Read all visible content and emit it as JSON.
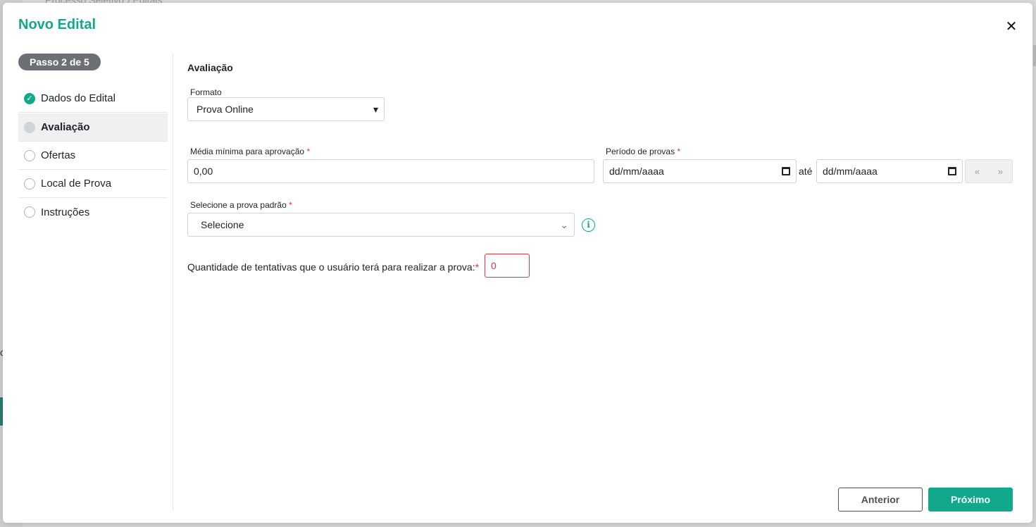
{
  "background": {
    "breadcrumb": "Processo Seletivo  ›  Editais",
    "edge_letter": "o"
  },
  "modal": {
    "title": "Novo Edital",
    "close_glyph": "✕"
  },
  "sidebar": {
    "step_badge": "Passo 2 de 5",
    "steps": [
      {
        "label": "Dados do Edital",
        "state": "done"
      },
      {
        "label": "Avaliação",
        "state": "current"
      },
      {
        "label": "Ofertas",
        "state": "pending"
      },
      {
        "label": "Local de Prova",
        "state": "pending"
      },
      {
        "label": "Instruções",
        "state": "pending"
      }
    ]
  },
  "form": {
    "section_title": "Avaliação",
    "formato": {
      "label": "Formato",
      "value": "Prova Online"
    },
    "media": {
      "label": "Média mínima para aprovação",
      "required": "*",
      "value": "0,00"
    },
    "periodo": {
      "label": "Período de provas",
      "required": "*",
      "start_placeholder": "dd/mm/aaaa",
      "separator": "até",
      "end_placeholder": "dd/mm/aaaa",
      "nav_prev": "«",
      "nav_next": "»"
    },
    "prova_padrao": {
      "label": "Selecione a prova padrão",
      "required": "*",
      "value": "Selecione",
      "info_glyph": "i"
    },
    "tentativas": {
      "label": "Quantidade de tentativas que o usuário terá para realizar a prova:",
      "required": "*",
      "value": "0"
    }
  },
  "footer": {
    "prev_label": "Anterior",
    "next_label": "Próximo"
  },
  "colors": {
    "accent": "#11a88b",
    "danger": "#dc3545",
    "badge": "#6c7075"
  }
}
